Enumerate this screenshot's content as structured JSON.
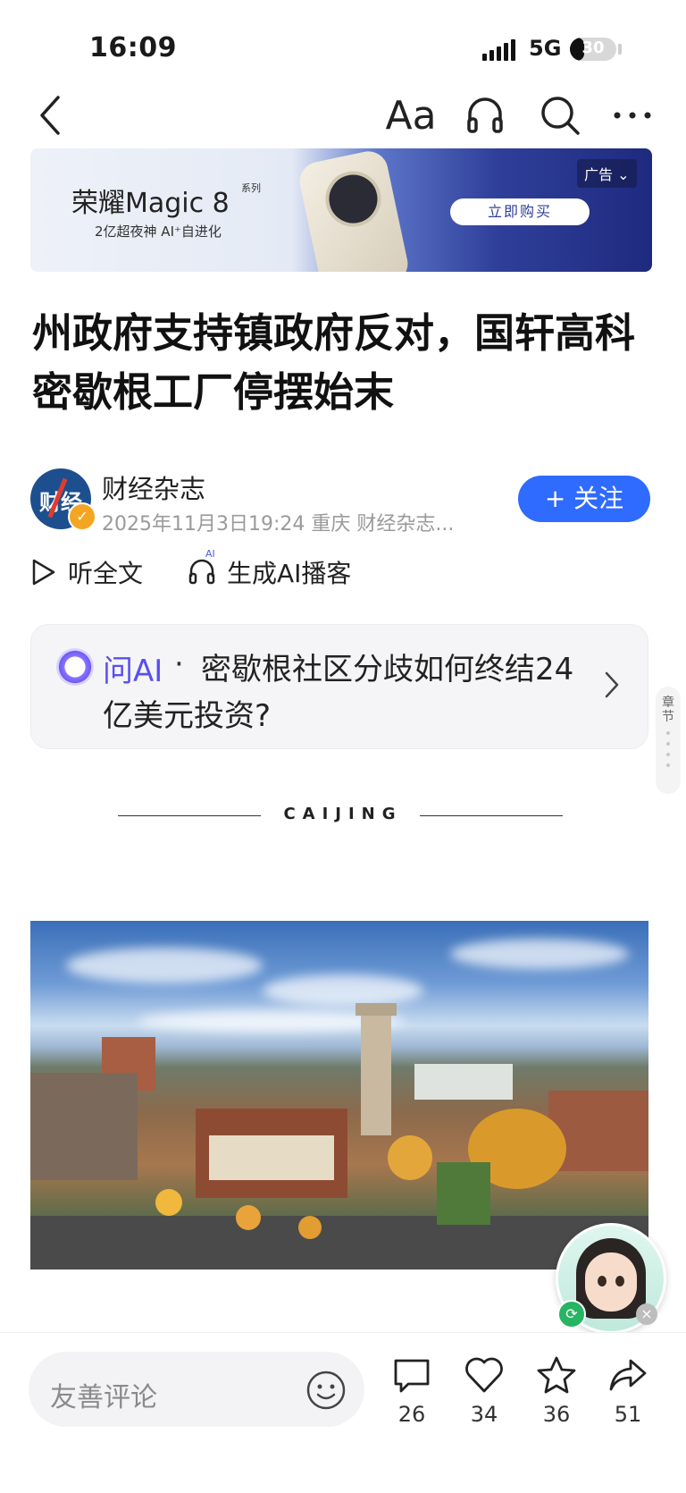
{
  "status_bar": {
    "time": "16:09",
    "network": "5G",
    "battery": "30",
    "battery_level": 0.3
  },
  "nav": {
    "font_icon": "Aa",
    "icons": [
      "back-arrow-icon",
      "headphones-icon",
      "search-icon",
      "more-icon"
    ]
  },
  "ad": {
    "brand": "荣耀Magic 8",
    "series": "系列",
    "subtitle": "2亿超夜神  AI⁺自进化",
    "cta": "立即购买",
    "tag": "广告"
  },
  "article": {
    "title": "州政府支持镇政府反对，国轩高科密歇根工厂停摆始末",
    "author": "财经杂志",
    "avatar_text": "财经",
    "meta": "2025年11月3日19:24 重庆 财经杂志...",
    "follow": "+ 关注"
  },
  "listen": {
    "full": "听全文",
    "podcast": "生成AI播客",
    "podcast_badge": "AI"
  },
  "ask_ai": {
    "label": "问AI",
    "separator": "·",
    "question": "密歇根社区分歧如何终结24亿美元投资?"
  },
  "chapter": {
    "label": "章节"
  },
  "divider": {
    "text": "CAIJING"
  },
  "bottom": {
    "comment_placeholder": "友善评论",
    "comments": "26",
    "likes": "34",
    "favorites": "36",
    "shares": "51"
  },
  "colors": {
    "accent": "#2f6bff",
    "ai_purple": "#5a4ff0",
    "text": "#1a1a1a",
    "muted": "#9a9a9a"
  }
}
